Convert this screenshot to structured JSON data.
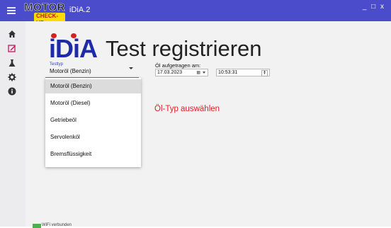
{
  "window": {
    "app_title": "iDiA.2",
    "controls": "_ □ x"
  },
  "logo": {
    "top": "MOTOR",
    "sub": "CHECK-UP"
  },
  "sidebar": {
    "items": [
      {
        "icon": "home-icon"
      },
      {
        "icon": "edit-icon"
      },
      {
        "icon": "flask-icon"
      },
      {
        "icon": "gear-icon"
      },
      {
        "icon": "info-icon"
      }
    ],
    "active_index": 1
  },
  "header": {
    "brand": "iDiA",
    "title": "Test registrieren"
  },
  "test_type": {
    "label": "Testtyp",
    "value": "Motoröl (Benzin)",
    "options": [
      "Motoröl (Benzin)",
      "Motoröl (Diesel)",
      "Getriebeöl",
      "Servolenköl",
      "Bremsflüssigkeit"
    ],
    "selected_index": 0
  },
  "oil_date": {
    "label": "Öl aufgetragen am:",
    "date": "17.03.2023",
    "time": "10:53:31"
  },
  "hint": "Öl-Typ auswählen",
  "status": {
    "text": "WiFi verbunden"
  },
  "colors": {
    "titlebar": "#4b4ccb",
    "brand_blue": "#1f2aa7",
    "brand_red": "#d81f1f",
    "hint_red": "#e02020",
    "active_nav": "#c2185b",
    "wifi_green": "#4caf50"
  }
}
